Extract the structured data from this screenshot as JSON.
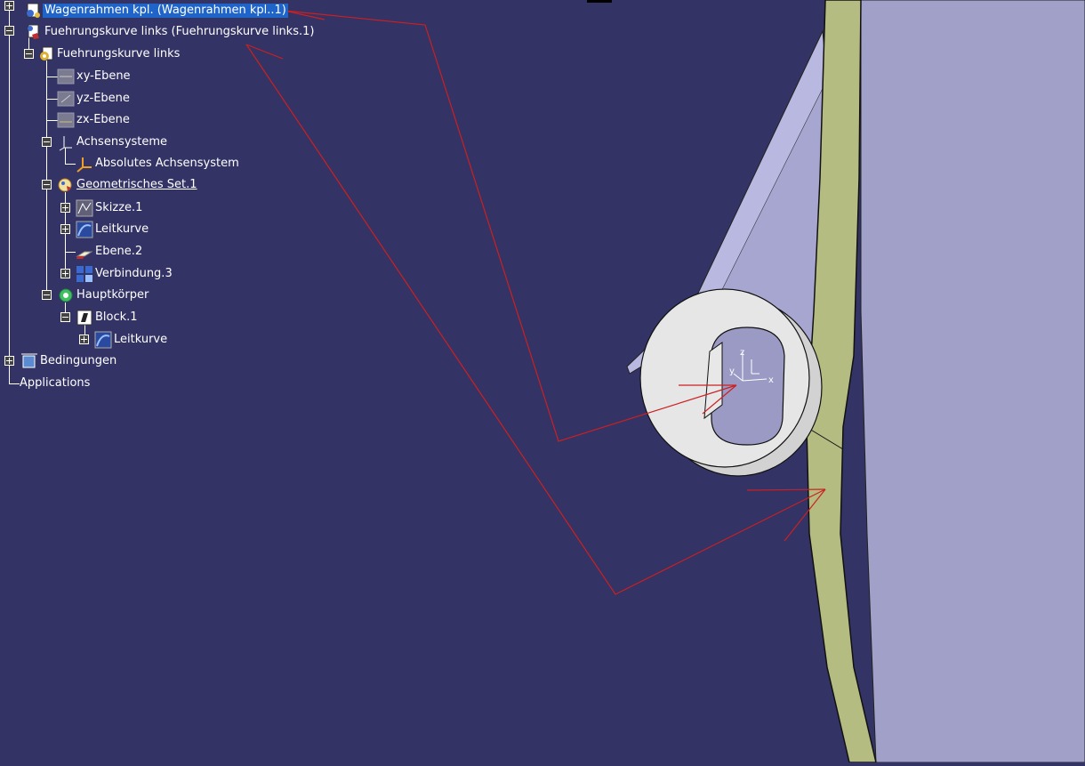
{
  "tree": {
    "root_label": "Wagenrahmen kpl. (Wagenrahmen kpl..1)",
    "part_label": "Fuehrungskurve links (Fuehrungskurve links.1)",
    "part_body_label": "Fuehrungskurve links",
    "plane_xy": "xy-Ebene",
    "plane_yz": "yz-Ebene",
    "plane_zx": "zx-Ebene",
    "axis_systems": "Achsensysteme",
    "absolute_axis": "Absolutes Achsensystem",
    "geo_set": "Geometrisches Set.1",
    "sketch": "Skizze.1",
    "guide_curve": "Leitkurve",
    "plane2": "Ebene.2",
    "join3": "Verbindung.3",
    "main_body": "Hauptkörper",
    "block": "Block.1",
    "block_guide_curve": "Leitkurve",
    "constraints": "Bedingungen",
    "applications": "Applications"
  },
  "viewport": {
    "compass_x": "x",
    "compass_y": "y",
    "compass_z": "z",
    "background_color": "#333366",
    "plate_color": "#a0a0c8",
    "rail_color": "#b4bc82",
    "roller_color": "#e6e6e6",
    "annotation_color": "#cc2020"
  }
}
